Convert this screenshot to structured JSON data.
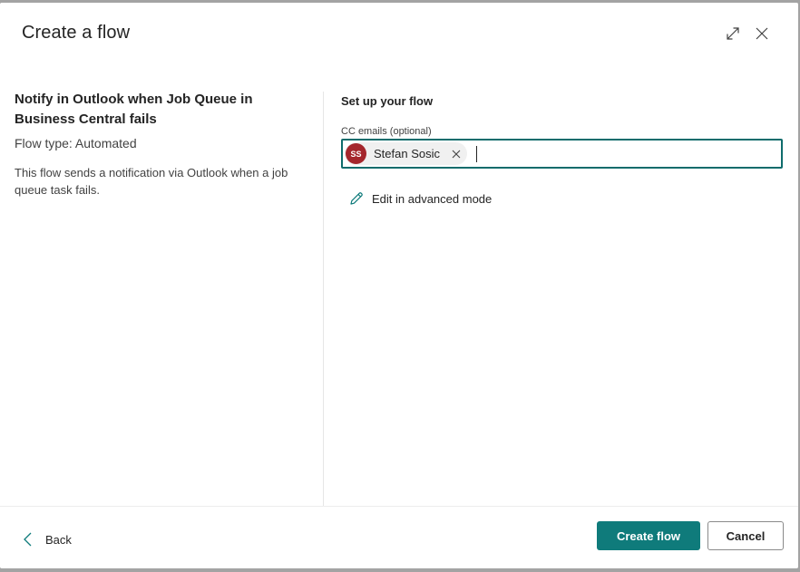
{
  "header": {
    "title": "Create a flow",
    "expand_icon": "expand-icon",
    "close_icon": "close-icon"
  },
  "left": {
    "flow_name": "Notify in Outlook when Job Queue in Business Central fails",
    "flow_type": "Flow type: Automated",
    "description": "This flow sends a notification via Outlook when a job queue task fails."
  },
  "right": {
    "section_title": "Set up your flow",
    "cc_label": "CC emails (optional)",
    "recipient": {
      "initials": "SS",
      "name": "Stefan Sosic",
      "avatar_color": "#a4262c"
    },
    "cc_input_value": "",
    "advanced_link": "Edit in advanced mode"
  },
  "footer": {
    "back_label": "Back",
    "create_label": "Create flow",
    "cancel_label": "Cancel"
  },
  "colors": {
    "accent": "#0f7b7b",
    "focus_border": "#0f6c6c"
  }
}
